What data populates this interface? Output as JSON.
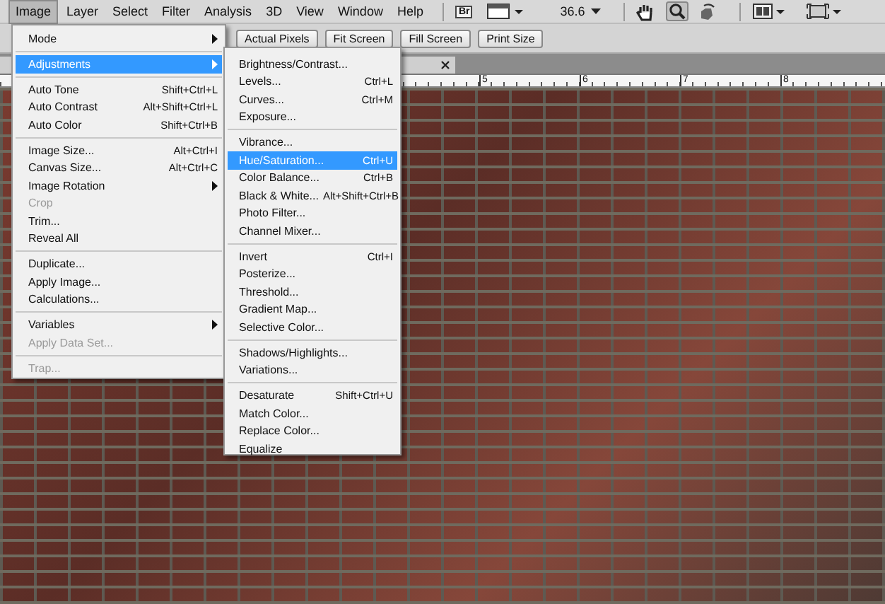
{
  "menu_bar": {
    "items": [
      {
        "label": "Image",
        "selected": true
      },
      {
        "label": "Layer",
        "selected": false
      },
      {
        "label": "Select",
        "selected": false
      },
      {
        "label": "Filter",
        "selected": false
      },
      {
        "label": "Analysis",
        "selected": false
      },
      {
        "label": "3D",
        "selected": false
      },
      {
        "label": "View",
        "selected": false
      },
      {
        "label": "Window",
        "selected": false
      },
      {
        "label": "Help",
        "selected": false
      }
    ],
    "bridge_label": "Br",
    "zoom_level": "36.6"
  },
  "options_bar": {
    "buttons": [
      "Actual Pixels",
      "Fit Screen",
      "Fill Screen",
      "Print Size"
    ]
  },
  "ruler": {
    "labels": [
      "5",
      "6",
      "7",
      "8"
    ]
  },
  "image_menu": {
    "items": [
      {
        "kind": "item",
        "label": "Mode",
        "has_submenu": true,
        "disabled": false,
        "selected": false
      },
      {
        "kind": "separator"
      },
      {
        "kind": "item",
        "label": "Adjustments",
        "has_submenu": true,
        "disabled": false,
        "selected": true
      },
      {
        "kind": "separator"
      },
      {
        "kind": "item",
        "label": "Auto Tone",
        "shortcut": "Shift+Ctrl+L",
        "disabled": false,
        "selected": false
      },
      {
        "kind": "item",
        "label": "Auto Contrast",
        "shortcut": "Alt+Shift+Ctrl+L",
        "disabled": false,
        "selected": false
      },
      {
        "kind": "item",
        "label": "Auto Color",
        "shortcut": "Shift+Ctrl+B",
        "disabled": false,
        "selected": false
      },
      {
        "kind": "separator"
      },
      {
        "kind": "item",
        "label": "Image Size...",
        "shortcut": "Alt+Ctrl+I",
        "disabled": false,
        "selected": false
      },
      {
        "kind": "item",
        "label": "Canvas Size...",
        "shortcut": "Alt+Ctrl+C",
        "disabled": false,
        "selected": false
      },
      {
        "kind": "item",
        "label": "Image Rotation",
        "has_submenu": true,
        "disabled": false,
        "selected": false
      },
      {
        "kind": "item",
        "label": "Crop",
        "disabled": true,
        "selected": false
      },
      {
        "kind": "item",
        "label": "Trim...",
        "disabled": false,
        "selected": false
      },
      {
        "kind": "item",
        "label": "Reveal All",
        "disabled": false,
        "selected": false
      },
      {
        "kind": "separator"
      },
      {
        "kind": "item",
        "label": "Duplicate...",
        "disabled": false,
        "selected": false
      },
      {
        "kind": "item",
        "label": "Apply Image...",
        "disabled": false,
        "selected": false
      },
      {
        "kind": "item",
        "label": "Calculations...",
        "disabled": false,
        "selected": false
      },
      {
        "kind": "separator"
      },
      {
        "kind": "item",
        "label": "Variables",
        "has_submenu": true,
        "disabled": false,
        "selected": false
      },
      {
        "kind": "item",
        "label": "Apply Data Set...",
        "disabled": true,
        "selected": false
      },
      {
        "kind": "separator"
      },
      {
        "kind": "item",
        "label": "Trap...",
        "disabled": true,
        "selected": false
      }
    ]
  },
  "adjustments_menu": {
    "items": [
      {
        "kind": "item",
        "label": "Brightness/Contrast...",
        "disabled": false,
        "selected": false
      },
      {
        "kind": "item",
        "label": "Levels...",
        "shortcut": "Ctrl+L",
        "disabled": false,
        "selected": false
      },
      {
        "kind": "item",
        "label": "Curves...",
        "shortcut": "Ctrl+M",
        "disabled": false,
        "selected": false
      },
      {
        "kind": "item",
        "label": "Exposure...",
        "disabled": false,
        "selected": false
      },
      {
        "kind": "separator"
      },
      {
        "kind": "item",
        "label": "Vibrance...",
        "disabled": false,
        "selected": false
      },
      {
        "kind": "item",
        "label": "Hue/Saturation...",
        "shortcut": "Ctrl+U",
        "disabled": false,
        "selected": true
      },
      {
        "kind": "item",
        "label": "Color Balance...",
        "shortcut": "Ctrl+B",
        "disabled": false,
        "selected": false
      },
      {
        "kind": "item",
        "label": "Black & White...",
        "shortcut": "Alt+Shift+Ctrl+B",
        "disabled": false,
        "selected": false
      },
      {
        "kind": "item",
        "label": "Photo Filter...",
        "disabled": false,
        "selected": false
      },
      {
        "kind": "item",
        "label": "Channel Mixer...",
        "disabled": false,
        "selected": false
      },
      {
        "kind": "separator"
      },
      {
        "kind": "item",
        "label": "Invert",
        "shortcut": "Ctrl+I",
        "disabled": false,
        "selected": false
      },
      {
        "kind": "item",
        "label": "Posterize...",
        "disabled": false,
        "selected": false
      },
      {
        "kind": "item",
        "label": "Threshold...",
        "disabled": false,
        "selected": false
      },
      {
        "kind": "item",
        "label": "Gradient Map...",
        "disabled": false,
        "selected": false
      },
      {
        "kind": "item",
        "label": "Selective Color...",
        "disabled": false,
        "selected": false
      },
      {
        "kind": "separator"
      },
      {
        "kind": "item",
        "label": "Shadows/Highlights...",
        "disabled": false,
        "selected": false
      },
      {
        "kind": "item",
        "label": "Variations...",
        "disabled": false,
        "selected": false
      },
      {
        "kind": "separator"
      },
      {
        "kind": "item",
        "label": "Desaturate",
        "shortcut": "Shift+Ctrl+U",
        "disabled": false,
        "selected": false
      },
      {
        "kind": "item",
        "label": "Match Color...",
        "disabled": false,
        "selected": false
      },
      {
        "kind": "item",
        "label": "Replace Color...",
        "disabled": false,
        "selected": false
      },
      {
        "kind": "item",
        "label": "Equalize",
        "disabled": false,
        "selected": false
      }
    ]
  }
}
